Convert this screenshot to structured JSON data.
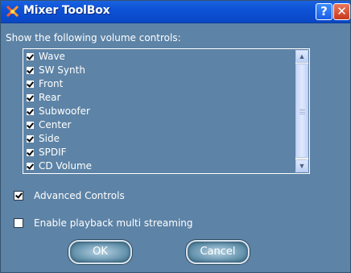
{
  "window": {
    "title": "Mixer ToolBox",
    "help_label": "?",
    "close_label": "✕"
  },
  "prompt": "Show the following volume controls:",
  "controls": [
    {
      "label": "Wave",
      "checked": true
    },
    {
      "label": "SW Synth",
      "checked": true
    },
    {
      "label": "Front",
      "checked": true
    },
    {
      "label": "Rear",
      "checked": true
    },
    {
      "label": "Subwoofer",
      "checked": true
    },
    {
      "label": "Center",
      "checked": true
    },
    {
      "label": "Side",
      "checked": true
    },
    {
      "label": "SPDIF",
      "checked": true
    },
    {
      "label": "CD Volume",
      "checked": true
    }
  ],
  "options": {
    "advanced": {
      "label": "Advanced Controls",
      "checked": true
    },
    "multi_streaming": {
      "label": "Enable playback multi streaming",
      "checked": false
    }
  },
  "buttons": {
    "ok": "OK",
    "cancel": "Cancel"
  },
  "icons": {
    "app": "mixer-icon",
    "help": "help-icon",
    "close": "close-icon",
    "scroll_up": "chevron-up-icon",
    "scroll_down": "chevron-down-icon"
  }
}
